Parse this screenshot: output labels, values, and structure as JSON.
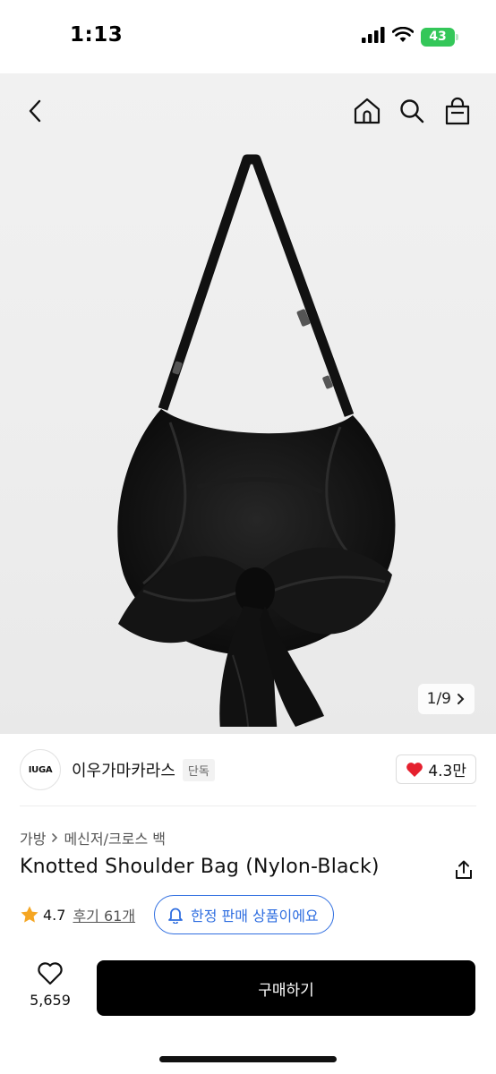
{
  "status_bar": {
    "time": "1:13",
    "battery": "43",
    "icons": [
      "signal-icon",
      "wifi-icon",
      "battery-icon"
    ]
  },
  "header": {
    "icons": [
      "back-icon",
      "home-icon",
      "search-icon",
      "shopping-bag-icon"
    ]
  },
  "gallery": {
    "counter": "1/9"
  },
  "brand": {
    "logo_text": "IUGA",
    "name": "이우가마카라스",
    "badge": "단독",
    "likes": "4.3만"
  },
  "product": {
    "breadcrumb": [
      "가방",
      "메신저/크로스 백"
    ],
    "title": "Knotted Shoulder Bag (Nylon-Black)",
    "rating": "4.7",
    "reviews": "후기 61개",
    "limited_label": "한정 판매 상품이에요"
  },
  "footer": {
    "wish_count": "5,659",
    "buy_label": "구매하기"
  },
  "colors": {
    "accent_blue": "#2f6ee0",
    "heart_red": "#e5202e",
    "star_orange": "#f5a623",
    "battery_green": "#34c759"
  }
}
